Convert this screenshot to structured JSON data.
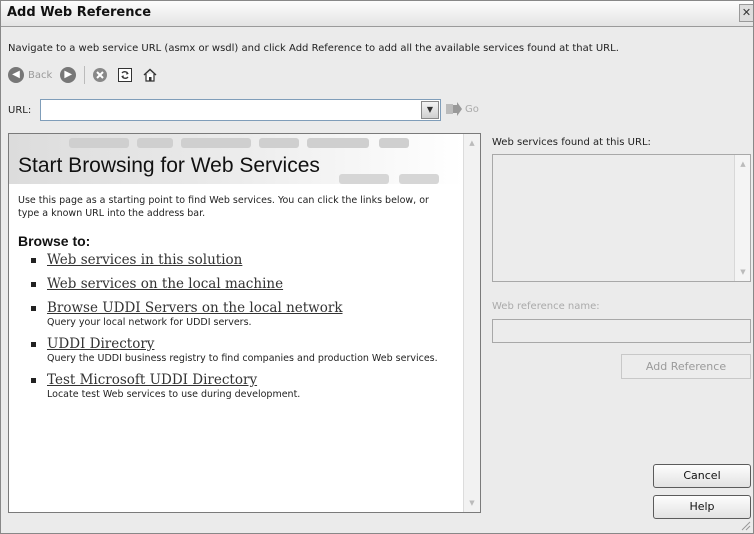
{
  "window": {
    "title": "Add Web Reference",
    "close_glyph": "✕"
  },
  "instructions": "Navigate to a web service URL (asmx or wsdl) and click Add Reference to add all the available services found at that URL.",
  "toolbar": {
    "back_label": "Back",
    "icons": [
      "back-icon",
      "forward-icon",
      "stop-icon",
      "refresh-icon",
      "home-icon"
    ]
  },
  "url_bar": {
    "label": "URL:",
    "value": "",
    "go_label": "Go"
  },
  "browser": {
    "heading": "Start Browsing for Web Services",
    "intro": "Use this page as a starting point to find Web services. You can click the links below, or type a known URL into the address bar.",
    "browse_to": "Browse to:",
    "links": [
      {
        "label": "Web services in this solution",
        "desc": ""
      },
      {
        "label": "Web services on the local machine",
        "desc": ""
      },
      {
        "label": "Browse UDDI Servers on the local network",
        "desc": "Query your local network for UDDI servers."
      },
      {
        "label": "UDDI Directory",
        "desc": "Query the UDDI business registry to find companies and production Web services."
      },
      {
        "label": "Test Microsoft UDDI Directory",
        "desc": "Locate test Web services to use during development."
      }
    ]
  },
  "side_panel": {
    "found_label": "Web services found at this URL:",
    "ref_name_label": "Web reference name:",
    "ref_name_value": "",
    "add_reference": "Add Reference"
  },
  "buttons": {
    "cancel": "Cancel",
    "help": "Help"
  },
  "colors": {
    "window_bg": "#ebebeb",
    "disabled_text": "#9a9a9a",
    "link_text": "#333333"
  }
}
